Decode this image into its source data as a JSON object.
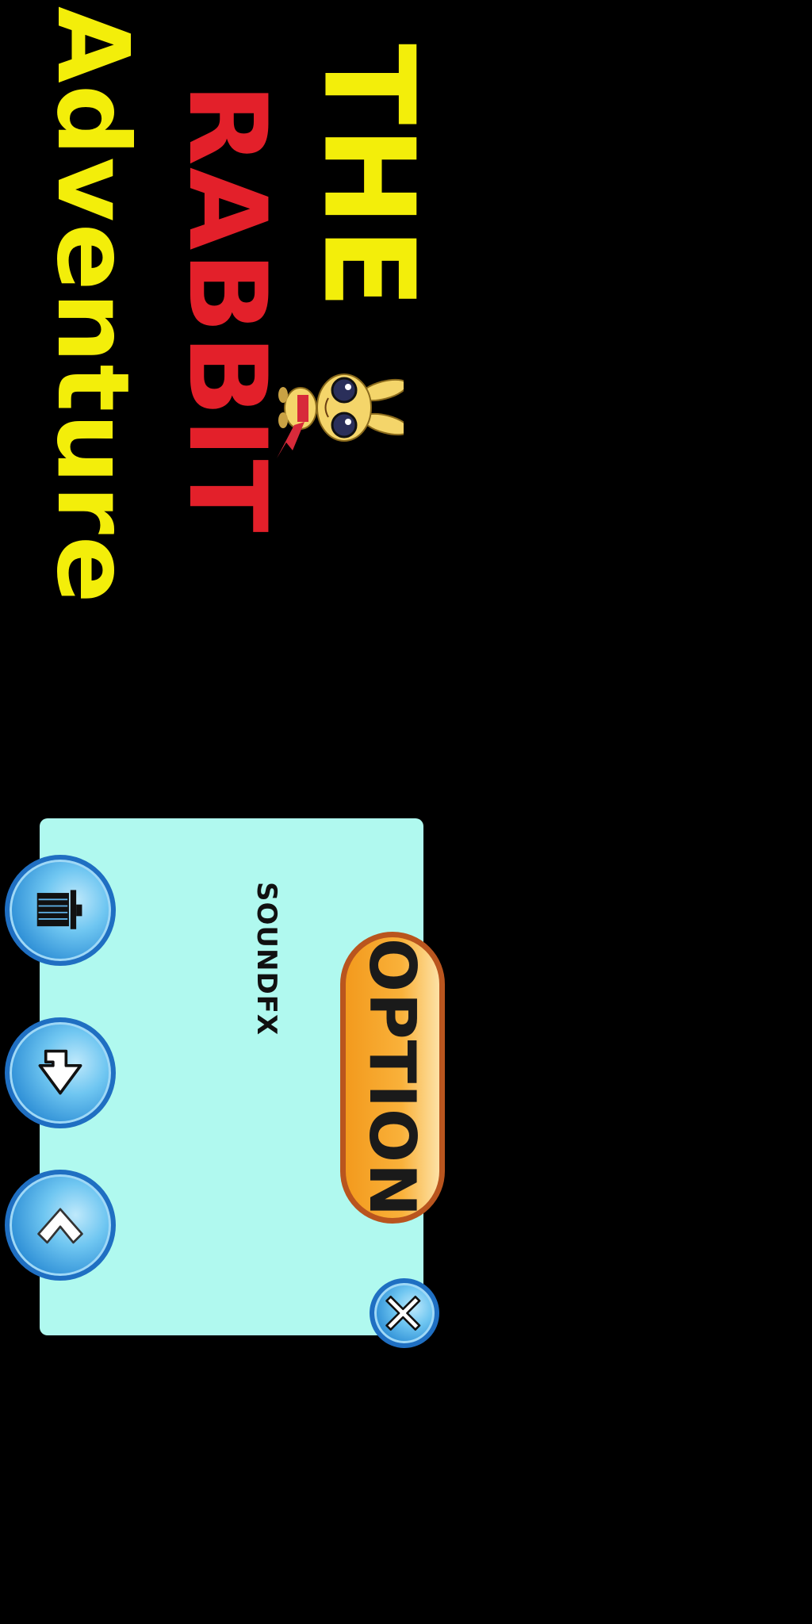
{
  "title": {
    "line1": "THE",
    "line2": "RABBIT",
    "line3": "Adventure"
  },
  "panel": {
    "heading": "OPTION",
    "label": "SOUNDFX"
  },
  "buttons": {
    "trash_icon": "trash-can-icon",
    "share_icon": "share-arrow-icon",
    "back_icon": "back-chevron-icon",
    "close_icon": "close-x-icon"
  },
  "colors": {
    "background": "#000000",
    "title_yellow": "#f3ee0a",
    "title_red": "#e3202a",
    "panel": "#b0f9ef",
    "option_orange": "#f9b13a",
    "button_blue": "#2e8fd6"
  }
}
